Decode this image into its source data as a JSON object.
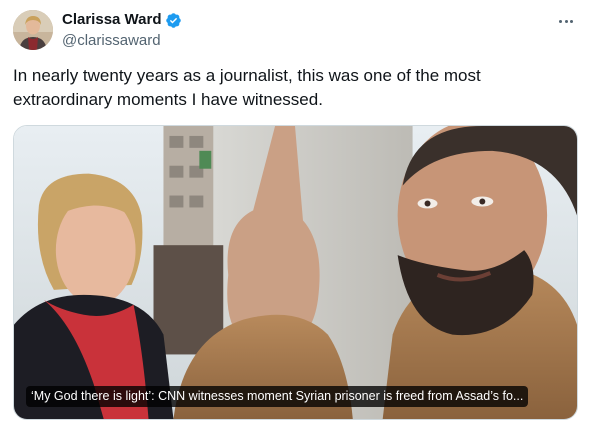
{
  "author": {
    "display_name": "Clarissa Ward",
    "handle": "@clarissaward",
    "verified_color": "#1d9bf0"
  },
  "post": {
    "text": "In nearly twenty years as a journalist, this was one of the most extraordinary moments I have witnessed."
  },
  "media": {
    "caption": "‘My God there is light’: CNN witnesses moment Syrian prisoner is freed from Assad’s fo..."
  },
  "icons": {
    "more": "more-horizontal-icon",
    "verified": "verified-badge-icon"
  }
}
